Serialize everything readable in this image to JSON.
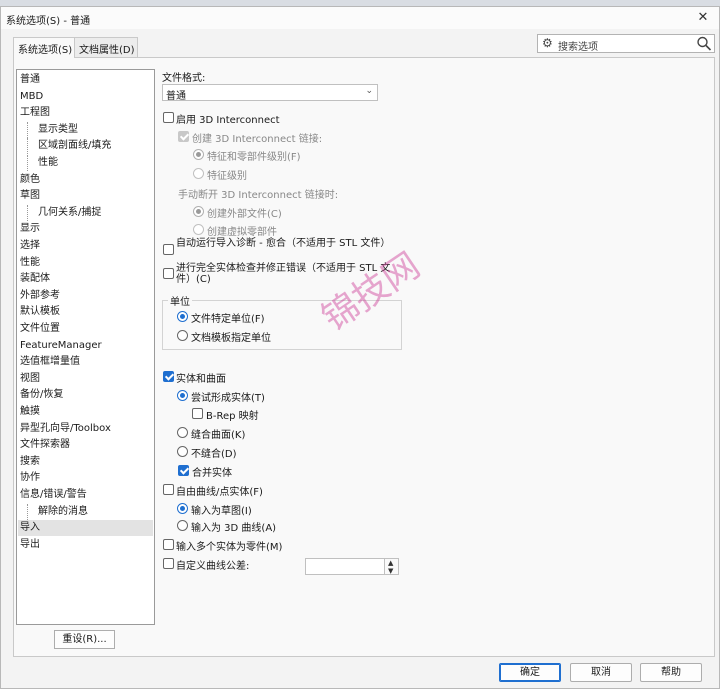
{
  "window": {
    "title": "系统选项(S) - 普通",
    "close_glyph": "✕"
  },
  "tabs": [
    {
      "label": "系统选项(S)",
      "active": true
    },
    {
      "label": "文档属性(D)",
      "active": false
    }
  ],
  "search": {
    "placeholder": "搜索选项",
    "icon_left": "gear-icon",
    "icon_right": "magnifier-icon"
  },
  "nav": {
    "items": [
      {
        "label": "普通",
        "child": false,
        "selected": false
      },
      {
        "label": "MBD",
        "child": false,
        "selected": false
      },
      {
        "label": "工程图",
        "child": false,
        "selected": false
      },
      {
        "label": "显示类型",
        "child": true,
        "selected": false
      },
      {
        "label": "区域剖面线/填充",
        "child": true,
        "selected": false
      },
      {
        "label": "性能",
        "child": true,
        "selected": false
      },
      {
        "label": "颜色",
        "child": false,
        "selected": false
      },
      {
        "label": "草图",
        "child": false,
        "selected": false
      },
      {
        "label": "几何关系/捕捉",
        "child": true,
        "selected": false
      },
      {
        "label": "显示",
        "child": false,
        "selected": false
      },
      {
        "label": "选择",
        "child": false,
        "selected": false
      },
      {
        "label": "性能",
        "child": false,
        "selected": false
      },
      {
        "label": "装配体",
        "child": false,
        "selected": false
      },
      {
        "label": "外部参考",
        "child": false,
        "selected": false
      },
      {
        "label": "默认模板",
        "child": false,
        "selected": false
      },
      {
        "label": "文件位置",
        "child": false,
        "selected": false
      },
      {
        "label": "FeatureManager",
        "child": false,
        "selected": false
      },
      {
        "label": "选值框增量值",
        "child": false,
        "selected": false
      },
      {
        "label": "视图",
        "child": false,
        "selected": false
      },
      {
        "label": "备份/恢复",
        "child": false,
        "selected": false
      },
      {
        "label": "触摸",
        "child": false,
        "selected": false
      },
      {
        "label": "异型孔向导/Toolbox",
        "child": false,
        "selected": false
      },
      {
        "label": "文件探索器",
        "child": false,
        "selected": false
      },
      {
        "label": "搜索",
        "child": false,
        "selected": false
      },
      {
        "label": "协作",
        "child": false,
        "selected": false
      },
      {
        "label": "信息/错误/警告",
        "child": false,
        "selected": false
      },
      {
        "label": "解除的消息",
        "child": true,
        "selected": false
      },
      {
        "label": "导入",
        "child": false,
        "selected": true
      },
      {
        "label": "导出",
        "child": false,
        "selected": false
      }
    ],
    "reset_label": "重设(R)..."
  },
  "content": {
    "file_format_label": "文件格式:",
    "file_format_value": "普通",
    "enable_3di": {
      "label": "启用 3D Interconnect",
      "checked": false
    },
    "create_3di_link": {
      "label": "创建 3D Interconnect 链接:",
      "checked": true,
      "disabled": true
    },
    "radio_feature_level": {
      "label": "特征和零部件级别(F)",
      "checked": true,
      "disabled": true
    },
    "radio_feature_only": {
      "label": "特征级别",
      "checked": false,
      "disabled": true
    },
    "manual_break_label": "手动断开 3D Interconnect 链接时:",
    "radio_create_external": {
      "label": "创建外部文件(C)",
      "checked": true,
      "disabled": true
    },
    "radio_create_virtual": {
      "label": "创建虚拟零部件",
      "checked": false,
      "disabled": true
    },
    "auto_diag": {
      "label": "自动运行导入诊断 - 愈合（不适用于 STL 文件）",
      "checked": false
    },
    "full_check": {
      "label": "进行完全实体检查并修正错误（不适用于 STL 文件）(C)",
      "checked": false
    },
    "units_group_title": "单位",
    "units_file_specific": {
      "label": "文件特定单位(F)",
      "checked": true
    },
    "units_doc_template": {
      "label": "文档模板指定单位",
      "checked": false
    },
    "solids_surfaces": {
      "label": "实体和曲面",
      "checked": true
    },
    "try_form_solid": {
      "label": "尝试形成实体(T)",
      "checked": true
    },
    "brep_mapping": {
      "label": "B-Rep 映射",
      "checked": false
    },
    "knit_surfaces": {
      "label": "缝合曲面(K)",
      "checked": false
    },
    "no_knit": {
      "label": "不缝合(D)",
      "checked": false
    },
    "merge_entities": {
      "label": "合并实体",
      "checked": true
    },
    "free_curves": {
      "label": "自由曲线/点实体(F)",
      "checked": false
    },
    "import_as_sketch": {
      "label": "输入为草图(I)",
      "checked": true
    },
    "import_as_3d_curve": {
      "label": "输入为 3D 曲线(A)",
      "checked": false
    },
    "multi_body_as_parts": {
      "label": "输入多个实体为零件(M)",
      "checked": false
    },
    "custom_curve_tol": {
      "label": "自定义曲线公差:",
      "checked": false,
      "value": ""
    }
  },
  "watermark": "锦技网",
  "footer": {
    "ok": "确定",
    "cancel": "取消",
    "help": "帮助"
  },
  "colors": {
    "accent": "#1f6fd0",
    "watermark": "#cc3c96"
  }
}
